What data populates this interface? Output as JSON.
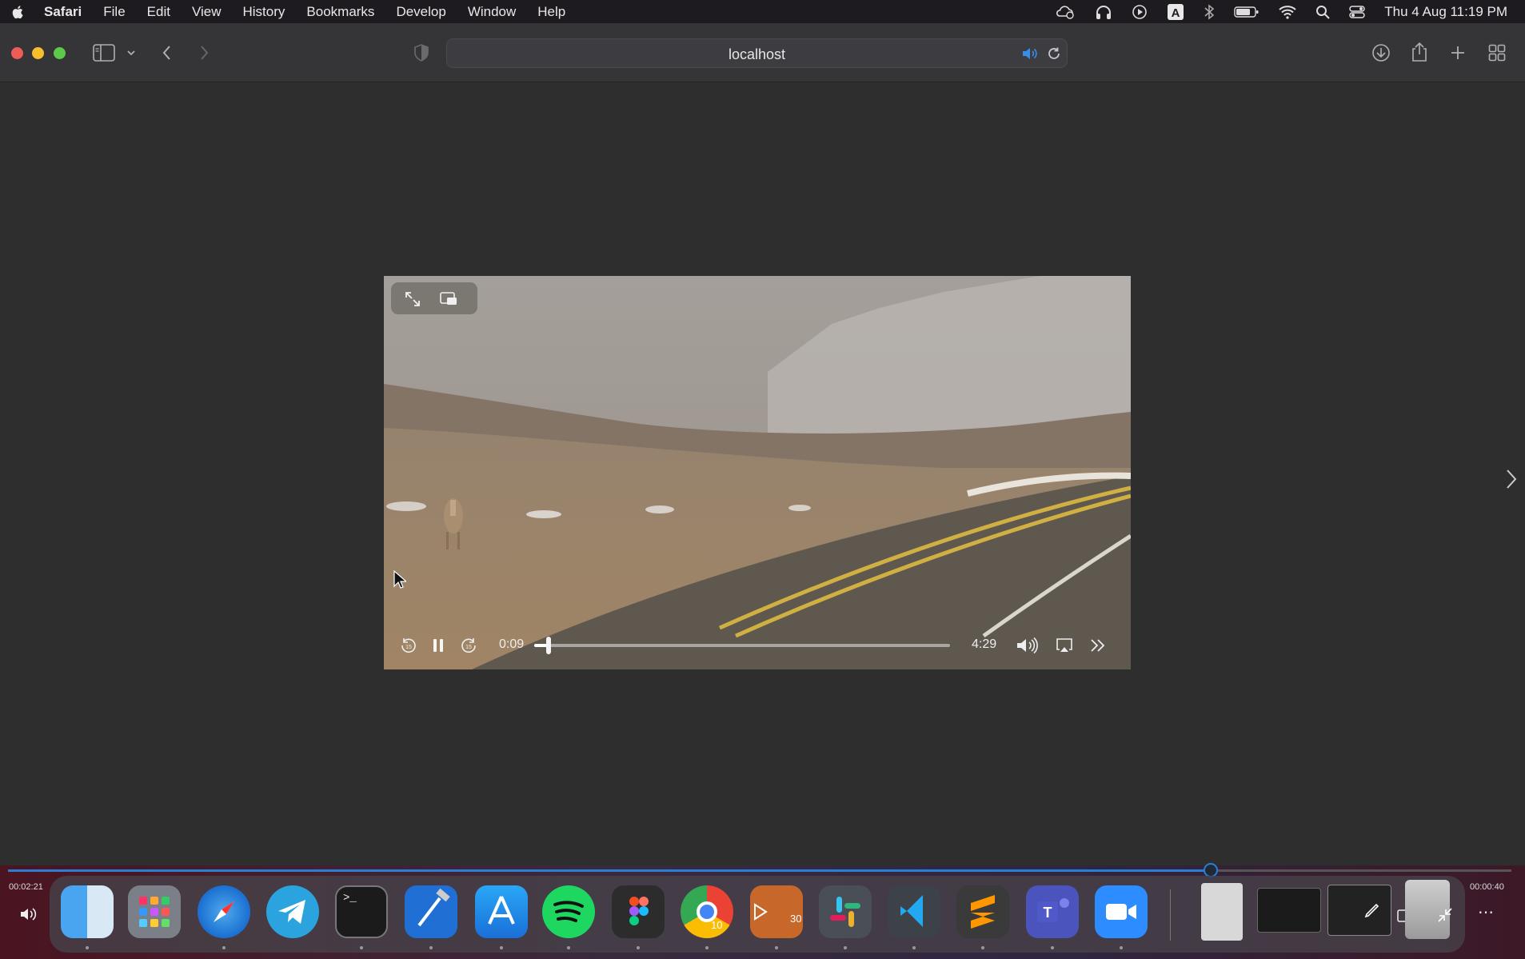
{
  "menubar": {
    "app_name": "Safari",
    "items": [
      "File",
      "Edit",
      "View",
      "History",
      "Bookmarks",
      "Develop",
      "Window",
      "Help"
    ],
    "datetime": "Thu 4 Aug  11:19 PM",
    "status_icons": [
      "cloud-icon",
      "headphones-icon",
      "play-circle-icon",
      "keyboard-a-icon",
      "bluetooth-icon",
      "battery-icon",
      "wifi-icon",
      "search-icon",
      "control-center-icon"
    ]
  },
  "toolbar": {
    "url": "localhost",
    "icons": [
      "sidebar-icon",
      "chevron-down-icon",
      "back-icon",
      "forward-icon",
      "shield-icon",
      "speaker-icon",
      "reload-icon",
      "download-icon",
      "share-icon",
      "new-tab-icon",
      "tab-overview-icon"
    ]
  },
  "video": {
    "current_time": "0:09",
    "duration": "4:29",
    "progress": 0.034
  },
  "player": {
    "elapsed": "00:02:21",
    "remaining": "00:00:40",
    "progress": 0.8,
    "skip_back_label": "10",
    "skip_forward_label": "30"
  },
  "dock": {
    "apps": [
      "finder",
      "launchpad",
      "safari",
      "telegram",
      "terminal",
      "xcode",
      "app-store",
      "spotify",
      "figma",
      "chrome",
      "script-editor",
      "slack",
      "vscode",
      "sublime-text",
      "teams",
      "zoom",
      "file",
      "window-thumb",
      "window-thumb-2",
      "trash"
    ]
  },
  "colors": {
    "accent": "#2a7fd4",
    "menubar_bg": "#1d1b1f",
    "toolbar_bg": "#353437",
    "content_bg": "#2e2e2e"
  }
}
